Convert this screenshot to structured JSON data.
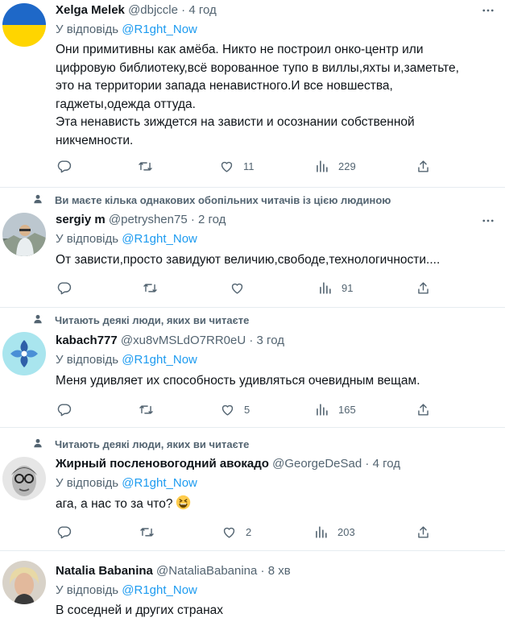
{
  "tweets": [
    {
      "name": "Xelga Melek",
      "handle": "@dbjccle",
      "sep": "·",
      "time": "4 год",
      "reply_prefix": "У відповідь",
      "reply_to": "@R1ght_Now",
      "lines": [
        "Они примитивны как амёба. Никто не построил онко-центр или",
        "цифровую библиотеку,всё ворованное тупо в виллы,яхты и,заметьте,",
        "это на территории запада ненавистного.И все новшества,",
        "гаджеты,одежда оттуда.",
        "Эта ненависть зиждется на зависти и осознании собственной",
        "никчемности."
      ],
      "likes": "11",
      "views": "229"
    },
    {
      "social_context": "Ви маєте кілька однакових обопільних читачів із цією людиною",
      "name": "sergiy m",
      "handle": "@petryshen75",
      "sep": "·",
      "time": "2 год",
      "reply_prefix": "У відповідь",
      "reply_to": "@R1ght_Now",
      "lines": [
        "От зависти,просто завидуют величию,свободе,технологичности...."
      ],
      "likes": "",
      "views": "91"
    },
    {
      "social_context": "Читають деякі люди, яких ви читаєте",
      "name": "kabach777",
      "handle": "@xu8vMSLdO7RR0eU",
      "sep": "·",
      "time": "3 год",
      "reply_prefix": "У відповідь",
      "reply_to": "@R1ght_Now",
      "lines": [
        "Меня удивляет их способность удивляться очевидным вещам."
      ],
      "likes": "5",
      "views": "165"
    },
    {
      "social_context": "Читають деякі люди, яких ви читаєте",
      "name": "Жирный посленовогодний авокадо",
      "handle": "@GeorgeDeSad",
      "sep": "·",
      "time": "4 год",
      "reply_prefix": "У відповідь",
      "reply_to": "@R1ght_Now",
      "lines": [
        "ага, а нас то за что?"
      ],
      "likes": "2",
      "views": "203"
    },
    {
      "name": "Natalia Babanina",
      "handle": "@NataliaBabanina",
      "sep": "·",
      "time": "8 хв",
      "reply_prefix": "У відповідь",
      "reply_to": "@R1ght_Now",
      "lines": [
        "В соседней и других странах"
      ]
    }
  ],
  "icons": {
    "reply": "comment-icon",
    "retweet": "retweet-icon",
    "like": "heart-icon",
    "views": "views-icon",
    "share": "share-icon",
    "more": "more-icon",
    "person": "person-icon"
  },
  "colors": {
    "text": "#0f1419",
    "muted": "#536471",
    "link": "#1d9bf0",
    "divider": "#e6ecf0"
  }
}
